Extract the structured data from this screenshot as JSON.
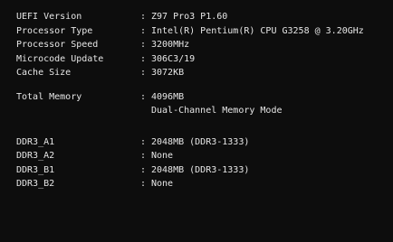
{
  "bios_info": {
    "rows": [
      {
        "label": "UEFI Version",
        "sep": ":",
        "value": "Z97 Pro3 P1.60"
      },
      {
        "label": "Processor Type",
        "sep": ":",
        "value": "Intel(R) Pentium(R) CPU G3258 @ 3.20GHz"
      },
      {
        "label": "Processor Speed",
        "sep": ":",
        "value": "3200MHz"
      },
      {
        "label": "Microcode Update",
        "sep": ":",
        "value": "306C3/19"
      },
      {
        "label": "Cache Size",
        "sep": ":",
        "value": "3072KB"
      }
    ]
  },
  "memory": {
    "label": "Total Memory",
    "sep": ":",
    "value": "4096MB",
    "mode": "Dual-Channel Memory Mode"
  },
  "slots": [
    {
      "label": "DDR3_A1",
      "sep": ":",
      "value": "2048MB (DDR3-1333)"
    },
    {
      "label": "DDR3_A2",
      "sep": ":",
      "value": "None"
    },
    {
      "label": "DDR3_B1",
      "sep": ":",
      "value": "2048MB (DDR3-1333)"
    },
    {
      "label": "DDR3_B2",
      "sep": ":",
      "value": "None"
    }
  ],
  "colors": {
    "background": "#0d0d0d",
    "text": "#e6e6e6"
  }
}
